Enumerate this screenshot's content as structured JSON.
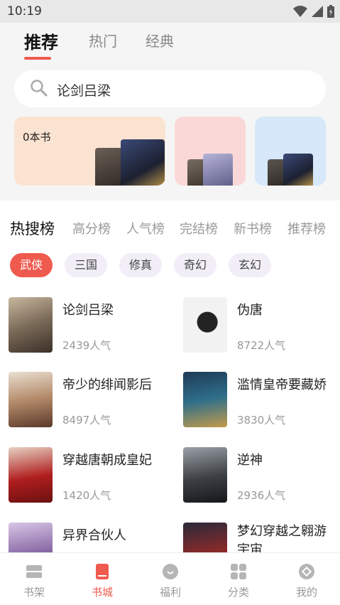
{
  "status": {
    "time": "10:19"
  },
  "tabs": [
    {
      "label": "推荐",
      "active": true
    },
    {
      "label": "热门",
      "active": false
    },
    {
      "label": "经典",
      "active": false
    }
  ],
  "search": {
    "text": "论剑吕梁"
  },
  "shelf": {
    "card1": {
      "count": "0本书"
    }
  },
  "rank_tabs": [
    "热搜榜",
    "高分榜",
    "人气榜",
    "完结榜",
    "新书榜",
    "推荐榜"
  ],
  "chips": [
    "武侠",
    "三国",
    "修真",
    "奇幻",
    "玄幻"
  ],
  "books": [
    {
      "title": "论剑吕梁",
      "popularity": "2439人气"
    },
    {
      "title": "伪唐",
      "popularity": "8722人气"
    },
    {
      "title": "帝少的绯闻影后",
      "popularity": "8497人气"
    },
    {
      "title": "滥情皇帝要藏娇",
      "popularity": "3830人气"
    },
    {
      "title": "穿越唐朝成皇妃",
      "popularity": "1420人气"
    },
    {
      "title": "逆神",
      "popularity": "2936人气"
    },
    {
      "title": "异界合伙人",
      "popularity": ""
    },
    {
      "title": "梦幻穿越之翱游宇宙",
      "popularity": ""
    }
  ],
  "nav": [
    {
      "label": "书架",
      "icon": "bookshelf-icon"
    },
    {
      "label": "书城",
      "icon": "bookstore-icon",
      "active": true
    },
    {
      "label": "福利",
      "icon": "gift-icon"
    },
    {
      "label": "分类",
      "icon": "category-icon"
    },
    {
      "label": "我的",
      "icon": "profile-icon"
    }
  ],
  "colors": {
    "accent": "#ef5a4f",
    "chip_bg": "#f1eef8"
  }
}
